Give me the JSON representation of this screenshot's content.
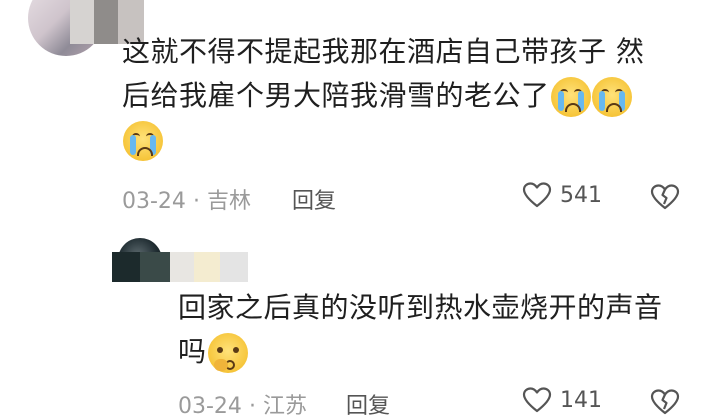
{
  "comments": [
    {
      "lines": [
        "这就不得不提起我那在酒店自己带孩子 然",
        "后给我雇个男大陪我滑雪的老公了"
      ],
      "emoji": "loudly-crying-face",
      "date": "03-24",
      "location": "吉林",
      "reply_label": "回复",
      "likes": "541"
    },
    {
      "lines": [
        "回家之后真的没听到热水壶烧开的声音",
        "吗"
      ],
      "emoji": "thinking-face",
      "date": "03-24",
      "location": "江苏",
      "reply_label": "回复",
      "likes": "141"
    }
  ]
}
